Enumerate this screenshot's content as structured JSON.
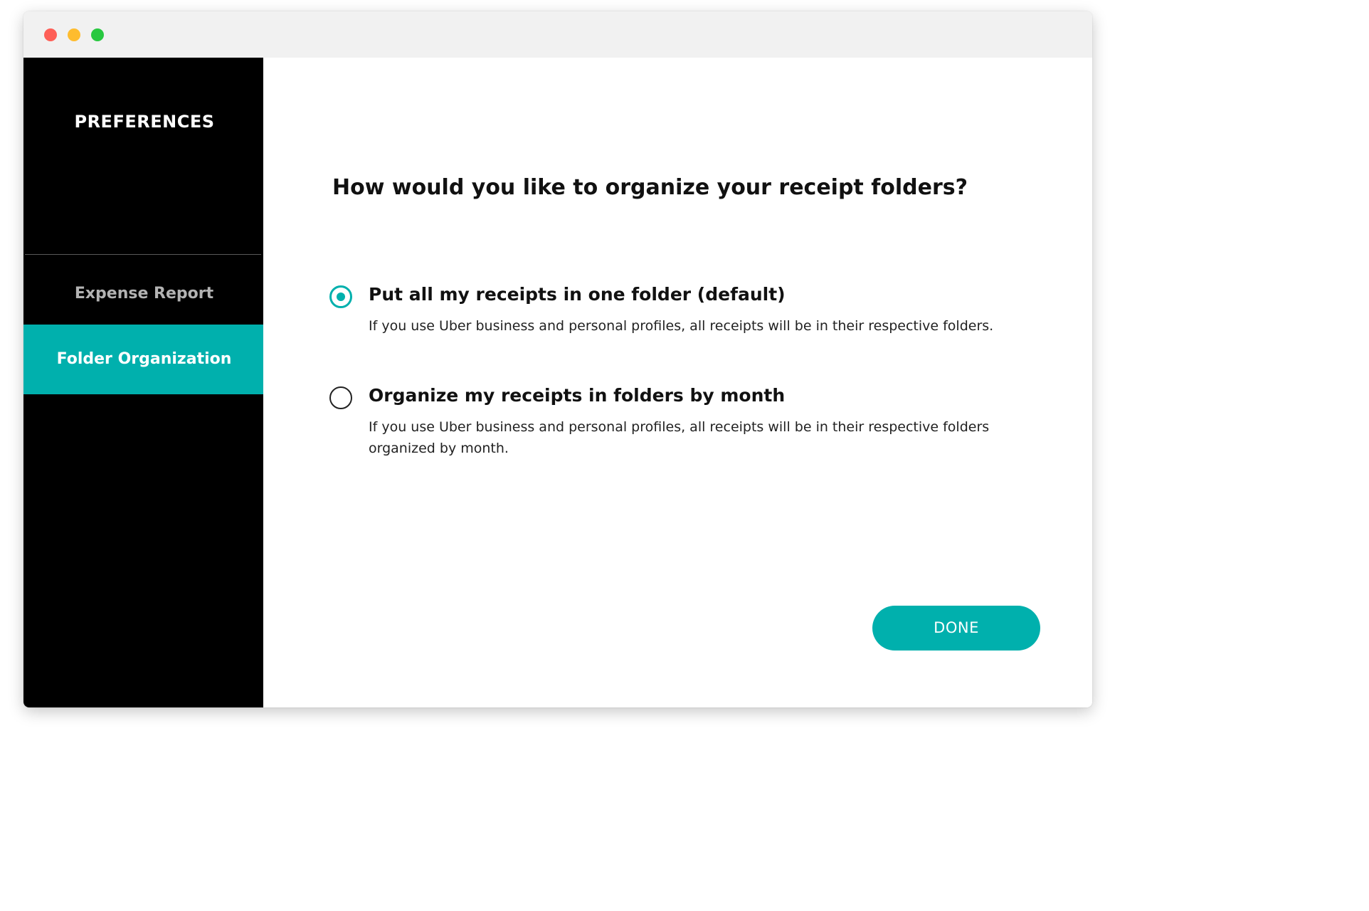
{
  "window": {
    "controls": [
      "close",
      "minimize",
      "zoom"
    ]
  },
  "sidebar": {
    "title": "PREFERENCES",
    "items": [
      {
        "label": "Expense Report",
        "active": false
      },
      {
        "label": "Folder Organization",
        "active": true
      }
    ]
  },
  "main": {
    "question": "How would you like to organize your receipt folders?",
    "options": [
      {
        "title": "Put all my receipts in one folder (default)",
        "description": "If you use Uber business and personal profiles, all receipts will be in their respective folders.",
        "selected": true
      },
      {
        "title": "Organize my receipts in folders by month",
        "description": "If you use Uber business and personal profiles, all receipts will be in their respective folders organized by month.",
        "selected": false
      }
    ],
    "done_label": "DONE"
  },
  "colors": {
    "accent": "#00b0ad",
    "sidebar_bg": "#000000",
    "titlebar_bg": "#f1f1f1",
    "close": "#fe5f57",
    "minimize": "#febc2e",
    "zoom": "#28c840"
  }
}
